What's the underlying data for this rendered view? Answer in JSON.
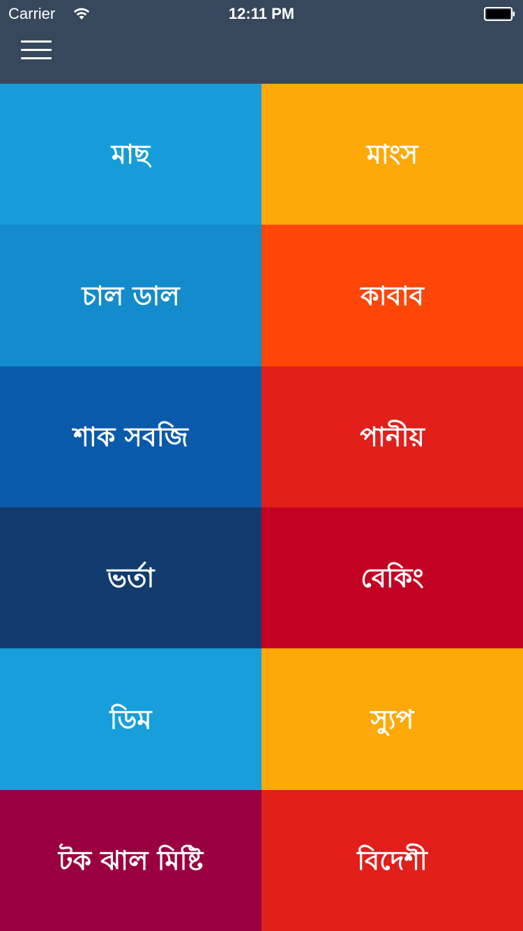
{
  "status_bar": {
    "carrier": "Carrier",
    "time": "12:11 PM",
    "wifi_icon": "wifi-icon",
    "battery_icon": "battery-icon"
  },
  "header": {
    "menu_icon": "hamburger-menu-icon",
    "background_color": "#37485c"
  },
  "categories": [
    {
      "label": "মাছ",
      "color": "#169dd9"
    },
    {
      "label": "মাংস",
      "color": "#fea80a"
    },
    {
      "label": "চাল ডাল",
      "color": "#138bcc"
    },
    {
      "label": "কাবাব",
      "color": "#fd4608"
    },
    {
      "label": "শাক সবজি",
      "color": "#0a5aac"
    },
    {
      "label": "পানীয়",
      "color": "#e11f1b"
    },
    {
      "label": "ভর্তা",
      "color": "#123c6d"
    },
    {
      "label": "বেকিং",
      "color": "#c30123"
    },
    {
      "label": "ডিম",
      "color": "#179fdb"
    },
    {
      "label": "স্যুপ",
      "color": "#fea80a"
    },
    {
      "label": "টক ঝাল মিষ্টি",
      "color": "#9a0040"
    },
    {
      "label": "বিদেশী",
      "color": "#e11f1b"
    }
  ]
}
